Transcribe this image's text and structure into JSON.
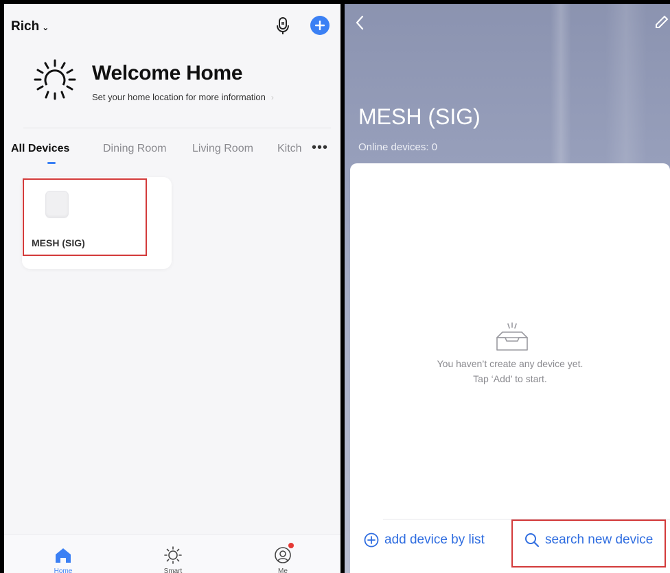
{
  "left": {
    "home_name": "Rich",
    "welcome_title": "Welcome Home",
    "welcome_subtitle": "Set your home location for more information",
    "tabs": [
      "All Devices",
      "Dining Room",
      "Living Room",
      "Kitch"
    ],
    "tab_more": "•••",
    "devices": [
      {
        "name": "MESH (SIG)"
      }
    ],
    "tabbar": [
      {
        "label": "Home",
        "icon": "home-icon"
      },
      {
        "label": "Smart",
        "icon": "sun-icon"
      },
      {
        "label": "Me",
        "icon": "profile-icon"
      }
    ]
  },
  "right": {
    "title": "MESH (SIG)",
    "online_devices": "Online devices: 0",
    "empty_line1": "You haven’t create any device yet.",
    "empty_line2": "Tap ‘Add’ to start.",
    "add_by_list": "add device by list",
    "search_new": "search new device"
  },
  "colors": {
    "accent": "#3b80f4",
    "link": "#2f6de0",
    "highlight": "#d33a3a"
  }
}
